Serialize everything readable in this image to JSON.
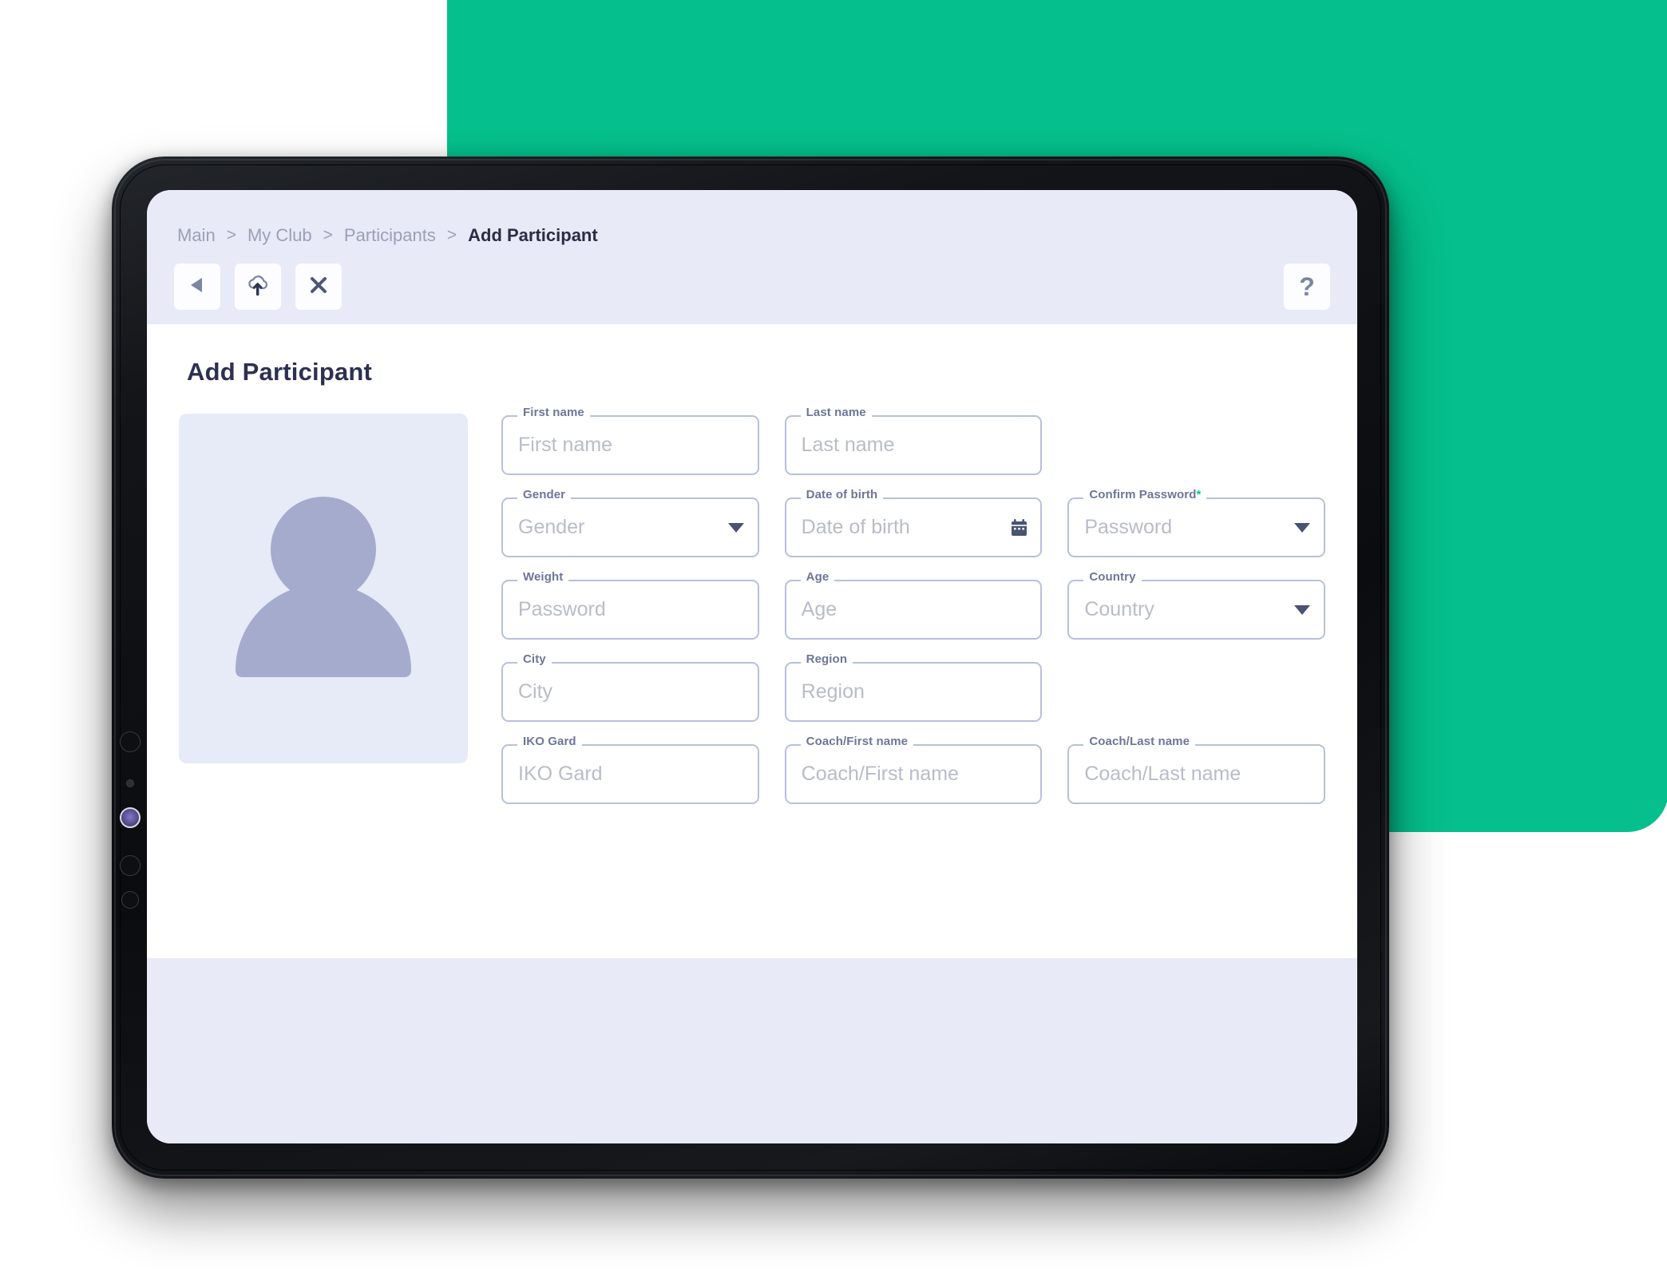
{
  "brand": {
    "green": "#05c08c",
    "lavender": "#e8eaf7",
    "outline": "#b7c0dc",
    "label": "#6d7698",
    "title": "#2e3050"
  },
  "breadcrumb": {
    "separator": ">",
    "items": [
      {
        "label": "Main",
        "active": false
      },
      {
        "label": "My Club",
        "active": false
      },
      {
        "label": "Participants",
        "active": false
      },
      {
        "label": "Add Participant",
        "active": true
      }
    ]
  },
  "toolbar": {
    "back_label": "back-arrow",
    "upload_label": "cloud-upload",
    "close_label": "close",
    "help_label": "?"
  },
  "page": {
    "title": "Add Participant"
  },
  "avatar": {
    "alt": "participant-photo-placeholder"
  },
  "form": {
    "fields": [
      {
        "label": "First name",
        "placeholder": "First name",
        "value": "",
        "adorn": "none",
        "required": false
      },
      {
        "label": "Last name",
        "placeholder": "Last name",
        "value": "",
        "adorn": "none",
        "required": false
      },
      {
        "label": "",
        "placeholder": "",
        "value": "",
        "adorn": "none",
        "required": false
      },
      {
        "label": "Gender",
        "placeholder": "Gender",
        "value": "",
        "adorn": "caret",
        "required": false
      },
      {
        "label": "Date of birth",
        "placeholder": "Date of birth",
        "value": "",
        "adorn": "calendar",
        "required": false
      },
      {
        "label": "Confirm Password",
        "placeholder": "Password",
        "value": "",
        "adorn": "caret",
        "required": true
      },
      {
        "label": "Weight",
        "placeholder": "Password",
        "value": "",
        "adorn": "none",
        "required": false
      },
      {
        "label": "Age",
        "placeholder": "Age",
        "value": "",
        "adorn": "none",
        "required": false
      },
      {
        "label": "Country",
        "placeholder": "Country",
        "value": "",
        "adorn": "caret",
        "required": false
      },
      {
        "label": "City",
        "placeholder": "City",
        "value": "",
        "adorn": "none",
        "required": false
      },
      {
        "label": "Region",
        "placeholder": "Region",
        "value": "",
        "adorn": "none",
        "required": false
      },
      {
        "label": "",
        "placeholder": "",
        "value": "",
        "adorn": "none",
        "required": false
      },
      {
        "label": "IKO Gard",
        "placeholder": "IKO Gard",
        "value": "",
        "adorn": "none",
        "required": false
      },
      {
        "label": "Coach/First name",
        "placeholder": "Coach/First name",
        "value": "",
        "adorn": "none",
        "required": false
      },
      {
        "label": "Coach/Last name",
        "placeholder": "Coach/Last name",
        "value": "",
        "adorn": "none",
        "required": false
      }
    ]
  }
}
